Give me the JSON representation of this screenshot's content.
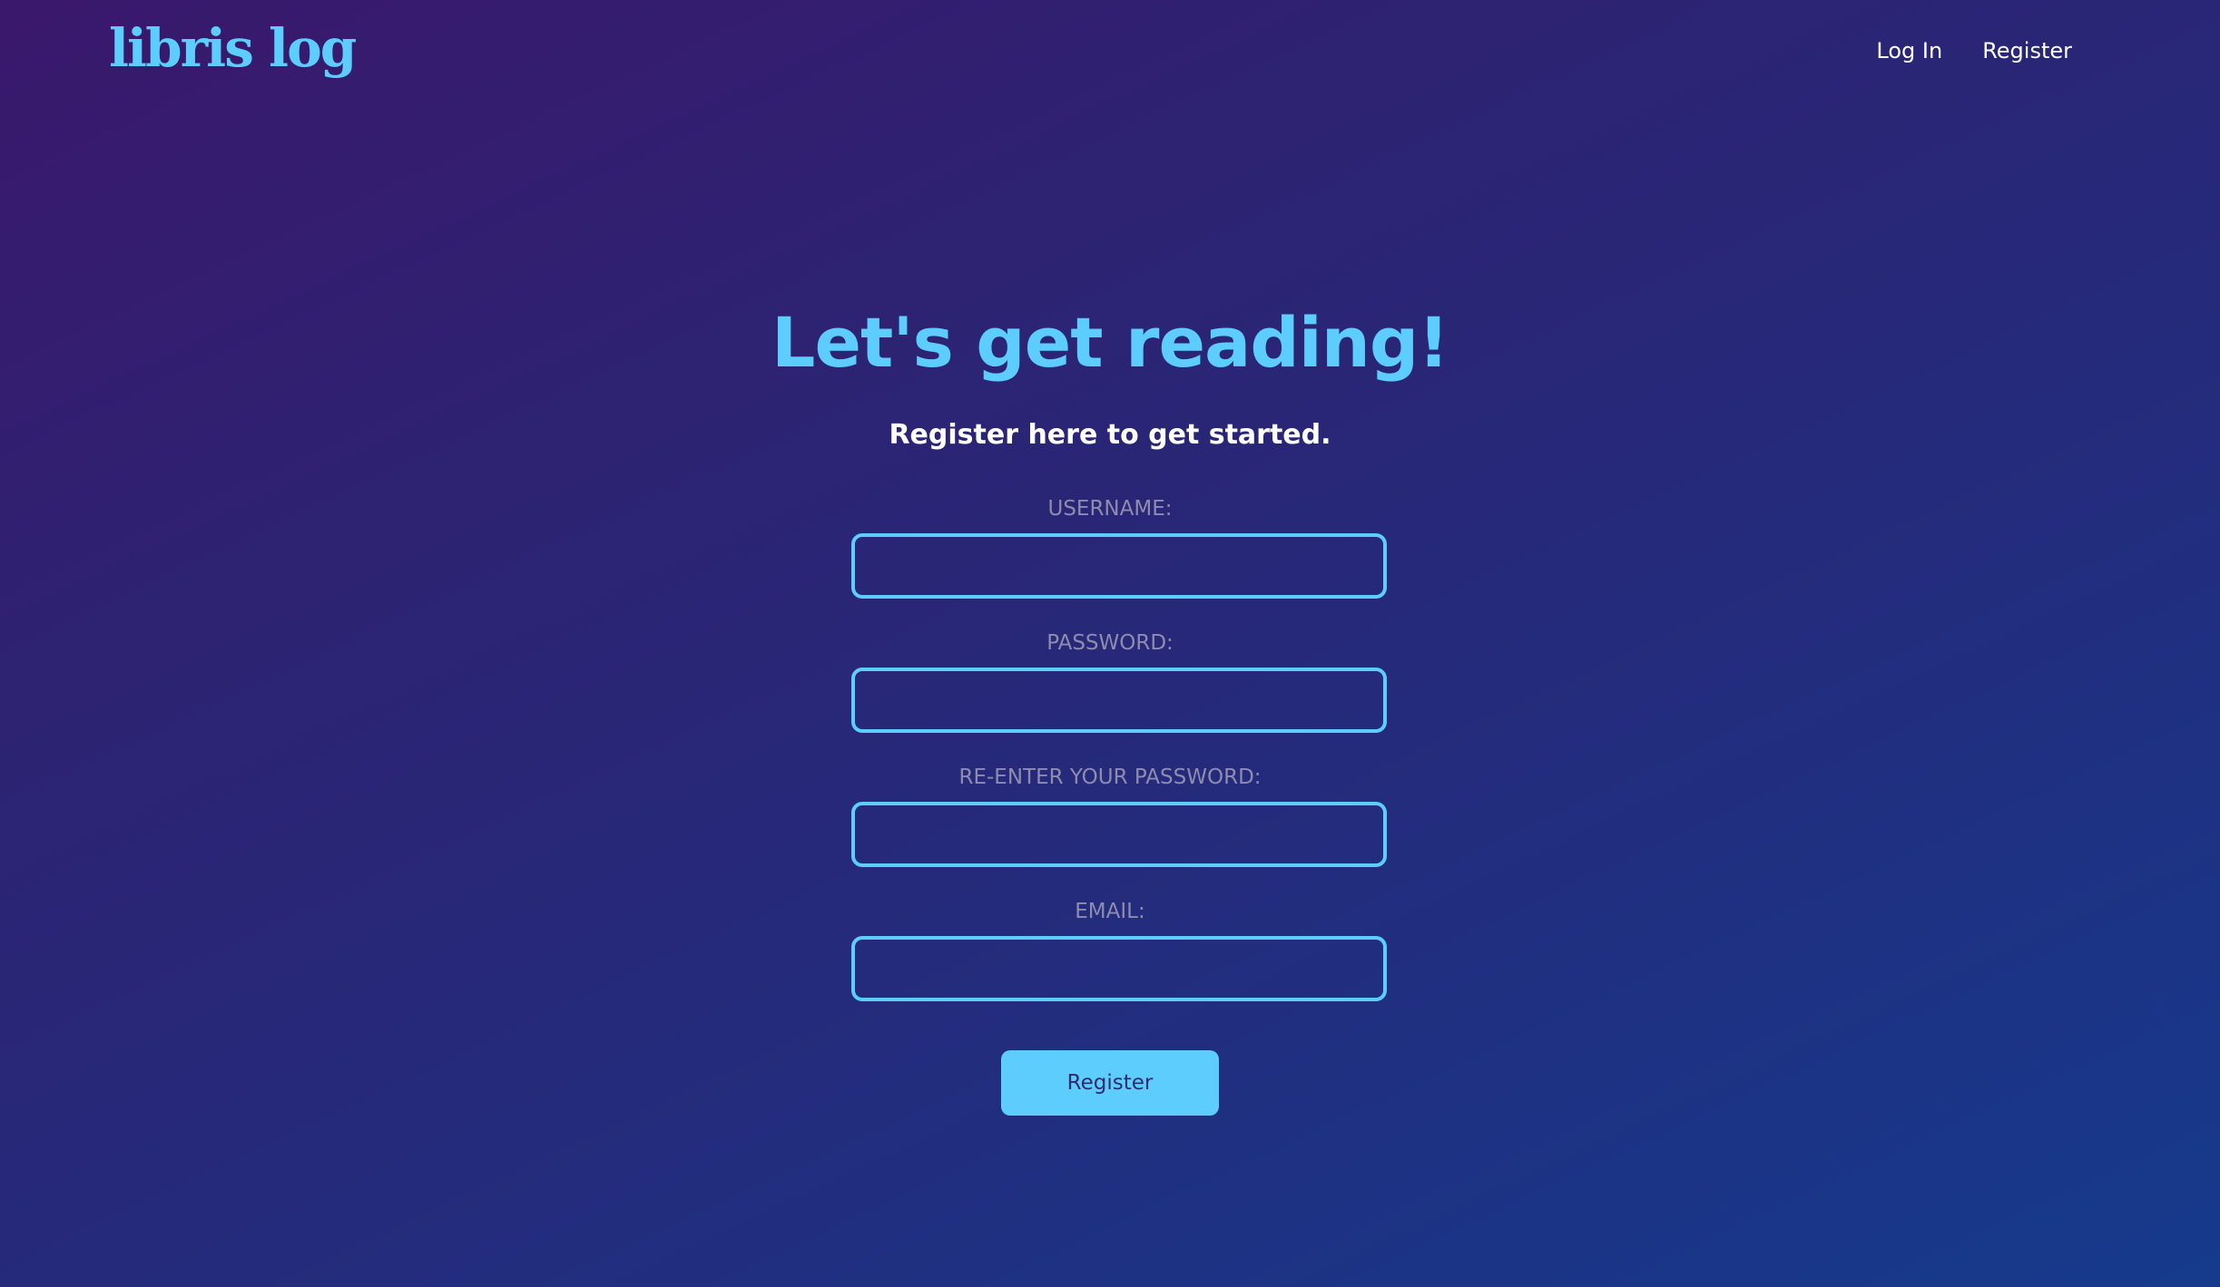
{
  "header": {
    "logo": "libris log",
    "nav": {
      "login": "Log In",
      "register": "Register"
    }
  },
  "main": {
    "title": "Let's get reading!",
    "subtitle": "Register here to get started.",
    "form": {
      "username_label": "USERNAME:",
      "password_label": "PASSWORD:",
      "confirm_password_label": "RE-ENTER YOUR PASSWORD:",
      "email_label": "EMAIL:",
      "submit_label": "Register"
    }
  },
  "colors": {
    "accent": "#5ccdfd",
    "label": "#8e8cae",
    "background_start": "#3a186c",
    "background_end": "#163a8c"
  }
}
